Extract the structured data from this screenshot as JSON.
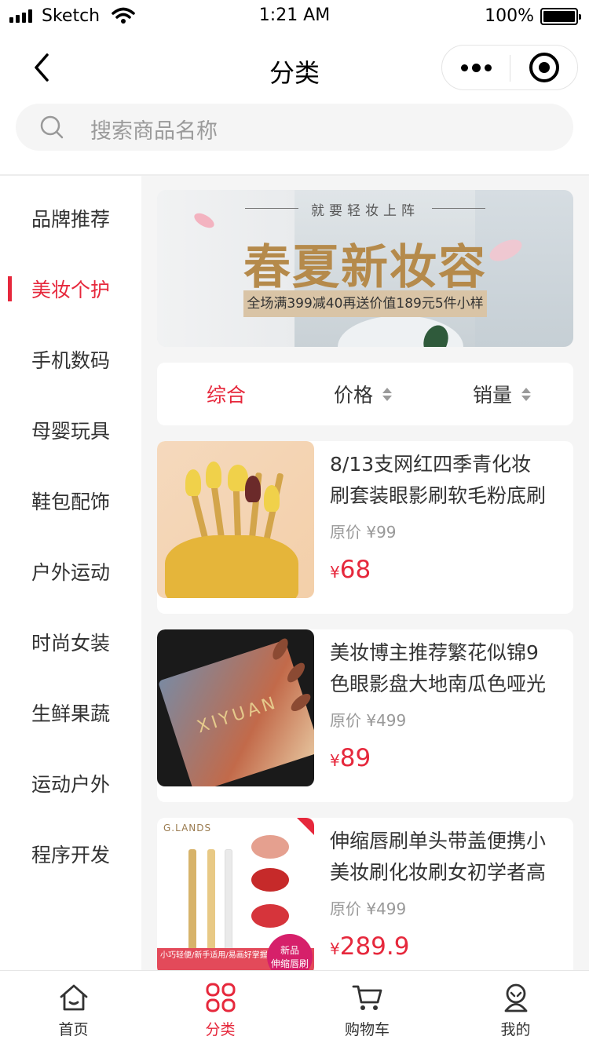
{
  "status_bar": {
    "carrier": "Sketch",
    "time": "1:21 AM",
    "battery": "100%"
  },
  "nav": {
    "title": "分类",
    "back_icon": "chevron-left-icon",
    "more_icon": "more-dots-icon",
    "close_icon": "target-close-icon"
  },
  "search": {
    "placeholder": "搜索商品名称",
    "icon": "search-icon"
  },
  "sidebar": {
    "active_index": 1,
    "items": [
      {
        "label": "品牌推荐"
      },
      {
        "label": "美妆个护"
      },
      {
        "label": "手机数码"
      },
      {
        "label": "母婴玩具"
      },
      {
        "label": "鞋包配饰"
      },
      {
        "label": "户外运动"
      },
      {
        "label": "时尚女装"
      },
      {
        "label": "生鲜果蔬"
      },
      {
        "label": "运动户外"
      },
      {
        "label": "程序开发"
      }
    ]
  },
  "banner": {
    "kicker": "就要轻妆上阵",
    "title": "春夏新妆容",
    "promo": "全场满399减40再送价值189元5件小样"
  },
  "sort": {
    "tabs": [
      {
        "label": "综合",
        "active": true
      },
      {
        "label": "价格",
        "active": false
      },
      {
        "label": "销量",
        "active": false
      }
    ]
  },
  "products": [
    {
      "name_line1": "8/13支网红四季青化妆",
      "name_line2": "刷套装眼影刷软毛粉底刷",
      "orig_price": "原价 ¥99",
      "currency": "¥",
      "price": "68"
    },
    {
      "name_line1": "美妆博主推荐繁花似锦9",
      "name_line2": "色眼影盘大地南瓜色哑光",
      "orig_price": "原价 ¥499",
      "currency": "¥",
      "price": "89",
      "thumb_text": "XIYUAN"
    },
    {
      "name_line1": "伸缩唇刷单头带盖便携小",
      "name_line2": "美妆刷化妆刷女初学者高",
      "orig_price": "原价 ¥499",
      "currency": "¥",
      "price": "289.9",
      "thumb_brand": "G.LANDS",
      "thumb_strip": "小巧轻便/新手适用/易画好掌握",
      "thumb_badge_1": "新品",
      "thumb_badge_2": "伸缩唇刷"
    }
  ],
  "tabbar": {
    "active_index": 1,
    "tabs": [
      {
        "label": "首页",
        "icon": "home-icon"
      },
      {
        "label": "分类",
        "icon": "category-icon"
      },
      {
        "label": "购物车",
        "icon": "cart-icon"
      },
      {
        "label": "我的",
        "icon": "profile-icon"
      }
    ]
  },
  "colors": {
    "accent": "#e6283c",
    "background": "#f5f5f5",
    "text": "#333333",
    "muted": "#999999"
  }
}
